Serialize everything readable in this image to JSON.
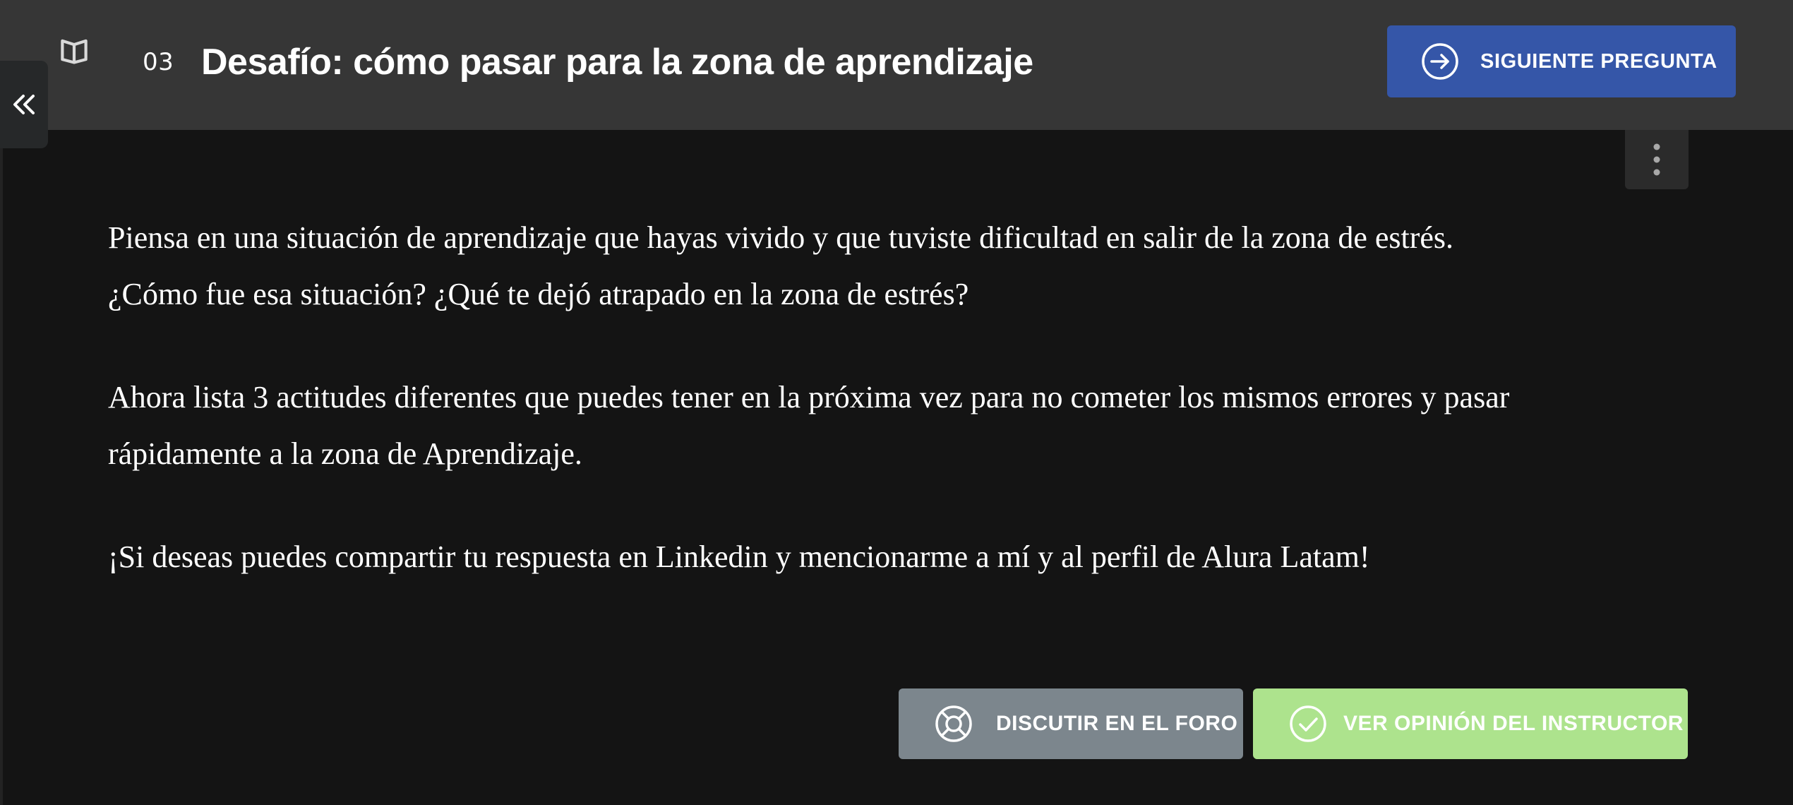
{
  "header": {
    "lesson_number": "03",
    "title": "Desafío: cómo pasar para la zona de aprendizaje",
    "next_button_label": "SIGUIENTE PREGUNTA",
    "logo_icon": "book-icon",
    "next_icon": "arrow-right-circle-icon"
  },
  "sidebar": {
    "toggle_icon": "double-chevron-left-icon"
  },
  "menu": {
    "more_icon": "vertical-dots-icon"
  },
  "content": {
    "paragraphs": [
      "Piensa en una situación de aprendizaje que hayas vivido y que tuviste dificultad en salir de la zona de estrés. ¿Cómo fue esa situación? ¿Qué te dejó atrapado en la zona de estrés?",
      "Ahora lista 3 actitudes diferentes que puedes tener en la próxima vez para no cometer los mismos errores y pasar rápidamente a la zona de Aprendizaje.",
      "¡Si deseas puedes compartir tu respuesta en Linkedin y mencionarme a mí y al perfil de Alura Latam!"
    ]
  },
  "actions": {
    "forum_button_label": "DISCUTIR EN EL FORO",
    "forum_icon": "lifebuoy-icon",
    "instructor_button_label": "VER OPINIÓN DEL INSTRUCTOR",
    "instructor_icon": "check-circle-icon"
  },
  "colors": {
    "header_background": "#363636",
    "page_background": "#141414",
    "primary_button": "#3556a8",
    "forum_button": "#7c868d",
    "instructor_button": "#ade38d",
    "text": "#ffffff"
  }
}
